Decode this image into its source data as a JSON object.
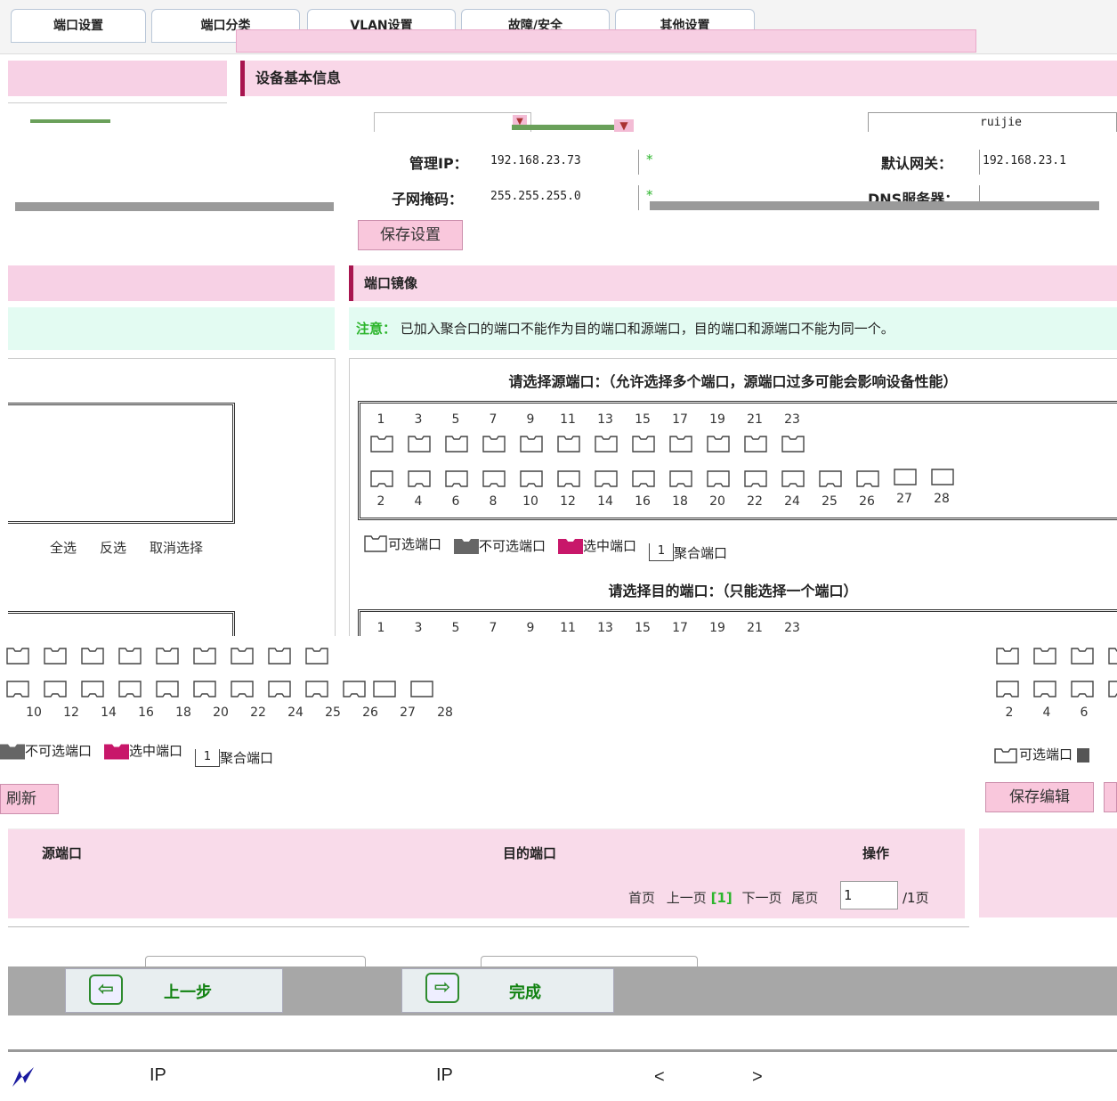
{
  "tabs": [
    "端口设置",
    "端口分类",
    "VLAN设置",
    "故障/安全",
    "其他设置"
  ],
  "device": {
    "header": "设备基本信息",
    "mgmt_ip_label": "管理IP：",
    "mgmt_ip_value": "192.168.23.73",
    "gateway_label": "默认网关：",
    "gateway_value": "192.168.23.1",
    "mask_label": "子网掩码：",
    "mask_value": "255.255.255.0",
    "dns_label": "DNS服务器：",
    "dns_value": "",
    "device_name_value": "ruijie",
    "required_mark": "*",
    "save_button": "保存设置"
  },
  "mirror": {
    "header": "端口镜像",
    "note_label": "注意：",
    "note_text": "已加入聚合口的端口不能作为目的端口和源端口，目的端口和源端口不能为同一个。",
    "source_title": "请选择源端口：（允许选择多个端口，源端口过多可能会影响设备性能）",
    "dest_title": "请选择目的端口：（只能选择一个端口）",
    "odd_ports": [
      "1",
      "3",
      "5",
      "7",
      "9",
      "11",
      "13",
      "15",
      "17",
      "19",
      "21",
      "23"
    ],
    "even_ports": [
      "2",
      "4",
      "6",
      "8",
      "10",
      "12",
      "14",
      "16",
      "18",
      "20",
      "22",
      "24",
      "25",
      "26",
      "27",
      "28"
    ],
    "legend": {
      "available": "可选端口",
      "unavailable": "不可选端口",
      "selected": "选中端口",
      "aggregate": "聚合端口",
      "aggregate_num": "1"
    },
    "select_all": "全选",
    "invert": "反选",
    "cancel_select": "取消选择",
    "refresh_button": "刷新",
    "save_edit_button": "保存编辑",
    "table": {
      "col_source": "源端口",
      "col_dest": "目的端口",
      "col_action": "操作"
    },
    "pagination": {
      "first": "首页",
      "prev": "上一页",
      "current": "[1]",
      "next": "下一页",
      "last": "尾页",
      "page_input": "1",
      "total": "/1页"
    }
  },
  "footer_bar": {
    "prev_button": "上一步",
    "finish_button": "完成"
  },
  "bottom_text": {
    "ip1": "IP",
    "ip2": "IP",
    "lt": "<",
    "gt": ">"
  },
  "left_lower": {
    "even_ports": [
      "10",
      "12",
      "14",
      "16",
      "18",
      "20",
      "22",
      "24",
      "25",
      "26",
      "27",
      "28"
    ],
    "legend_unavailable": "不可选端口",
    "legend_selected": "选中端口",
    "legend_aggregate": "聚合端口",
    "legend_num": "1"
  },
  "right_lower": {
    "even_ports": [
      "2",
      "4",
      "6"
    ],
    "legend_available": "可选端口"
  }
}
